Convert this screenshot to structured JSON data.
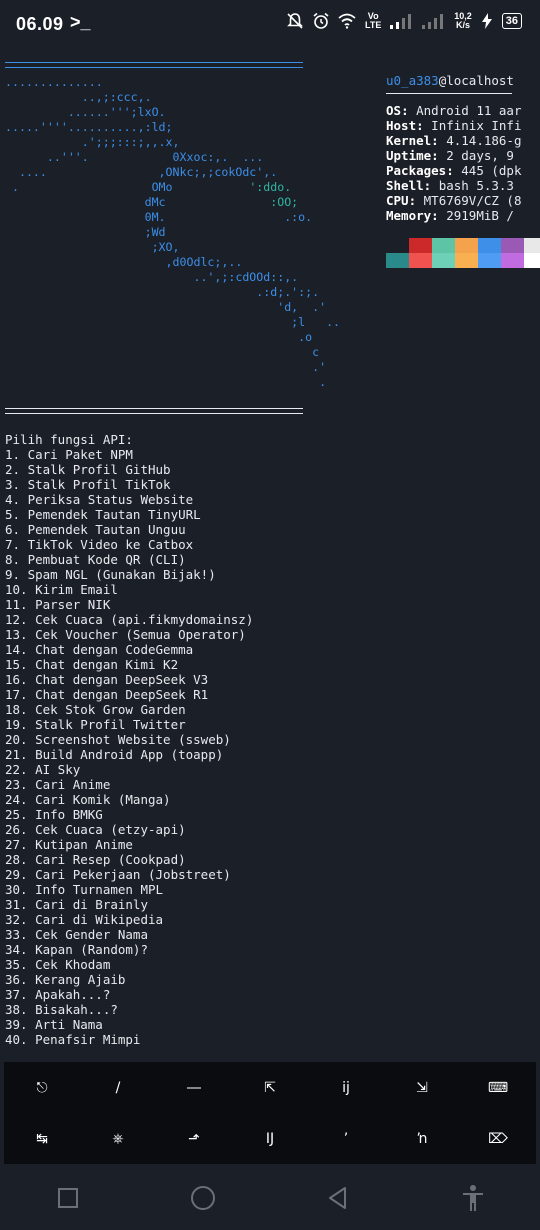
{
  "status_bar": {
    "time": "06.09",
    "prompt": ">_",
    "network": "Vo LTE",
    "speed_value": "10,2",
    "speed_unit": "K/s",
    "battery": "36"
  },
  "neofetch": {
    "ascii": [
      "..............",
      "           ..,;:ccc,.",
      "         ......''';lxO.",
      ".....''''..........,:ld;",
      "           .';;;:::;,,.x,",
      "      ..'''.            0Xxoc:,.  ...",
      "  ....                ,ONkc;,;cokOdc',.",
      " .                   OMo           ':ddo.",
      "                    dMc               :OO;",
      "                    0M.                 .:o.",
      "                    ;Wd",
      "                     ;XO,",
      "                       ,d0Odlc;,..",
      "                           ..',;:cdOOd::,.",
      "                                    .:d;.':;.",
      "                                       'd,  .'",
      "                                         ;l   ..",
      "                                          .o",
      "                                            c",
      "                                            .'",
      "                                             ."
    ],
    "user": "u0_a383",
    "host": "@localhost",
    "info": [
      {
        "label": "OS",
        "value": "Android 11 aar"
      },
      {
        "label": "Host",
        "value": "Infinix Infi"
      },
      {
        "label": "Kernel",
        "value": "4.14.186-g"
      },
      {
        "label": "Uptime",
        "value": "2 days, 9"
      },
      {
        "label": "Packages",
        "value": "445 (dpk"
      },
      {
        "label": "Shell",
        "value": "bash 5.3.3"
      },
      {
        "label": "CPU",
        "value": "MT6769V/CZ (8"
      },
      {
        "label": "Memory",
        "value": "2919MiB /"
      }
    ],
    "palette_top": [
      "#1b1f27",
      "#cc2a2a",
      "#5ec4a6",
      "#f4a24c",
      "#3d8fe8",
      "#9b59b6",
      "#e8e8e8"
    ],
    "palette_bottom": [
      "#2a8a8a",
      "#f0524f",
      "#6fd0b8",
      "#f8b050",
      "#4e9cf3",
      "#c16be0",
      "#ffffff"
    ]
  },
  "menu": {
    "title": "Pilih fungsi API:",
    "items": [
      "1. Cari Paket NPM",
      "2. Stalk Profil GitHub",
      "3. Stalk Profil TikTok",
      "4. Periksa Status Website",
      "5. Pemendek Tautan TinyURL",
      "6. Pemendek Tautan Unguu",
      "7. TikTok Video ke Catbox",
      "8. Pembuat Kode QR (CLI)",
      "9. Spam NGL (Gunakan Bijak!)",
      "10. Kirim Email",
      "11. Parser NIK",
      "12. Cek Cuaca (api.fikmydomainsz)",
      "13. Cek Voucher (Semua Operator)",
      "14. Chat dengan CodeGemma",
      "15. Chat dengan Kimi K2",
      "16. Chat dengan DeepSeek V3",
      "17. Chat dengan DeepSeek R1",
      "18. Cek Stok Grow Garden",
      "19. Stalk Profil Twitter",
      "20. Screenshot Website (ssweb)",
      "21. Build Android App (toapp)",
      "22. AI Sky",
      "23. Cari Anime",
      "24. Cari Komik (Manga)",
      "25. Info BMKG",
      "26. Cek Cuaca (etzy-api)",
      "27. Kutipan Anime",
      "28. Cari Resep (Cookpad)",
      "29. Cari Pekerjaan (Jobstreet)",
      "30. Info Turnamen MPL",
      "31. Cari di Brainly",
      "32. Cari di Wikipedia",
      "33. Cek Gender Nama",
      "34. Kapan (Random)?",
      "35. Cek Khodam",
      "36. Kerang Ajaib",
      "37. Apakah...?",
      "38. Bisakah...?",
      "39. Arti Nama",
      "40. Penafsir Mimpi"
    ]
  },
  "extra_keys": {
    "row1": [
      "⎋",
      "/",
      "―",
      "⇱",
      "ĳ",
      "⇲",
      "⌨"
    ],
    "row2": [
      "↹",
      "⎈",
      "⬏",
      "Ĳ",
      "’",
      "ŉ",
      "⌦"
    ]
  },
  "colors": {
    "background": "#1b1f27",
    "accent_blue": "#3d8fe8",
    "accent_teal": "#2fb5a4",
    "keys_background": "#0b0c0f"
  }
}
